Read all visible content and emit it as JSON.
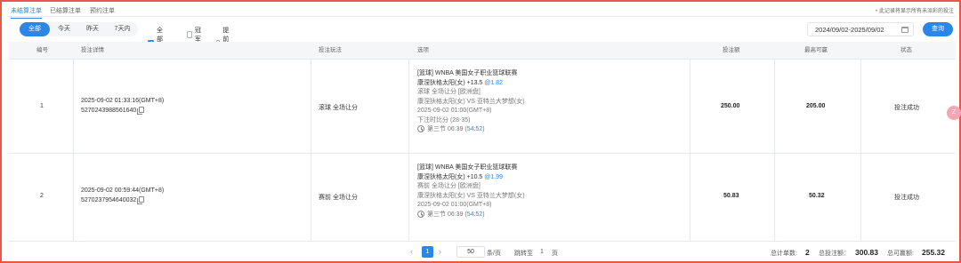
{
  "tabs": [
    {
      "label": "未结算注单",
      "active": true
    },
    {
      "label": "已结算注单",
      "active": false
    },
    {
      "label": "预约注单",
      "active": false
    }
  ],
  "notice": "此记录将显示所有未派彩的投注",
  "filters": {
    "ranges": [
      "全部",
      "今天",
      "昨天",
      "7天内"
    ],
    "active_range": "全部",
    "checkboxes": [
      {
        "label": "全部赛事",
        "checked": true
      },
      {
        "label": "冠军",
        "checked": false
      },
      {
        "label": "提前结算",
        "checked": false
      }
    ],
    "date_range": "2024/09/02-2025/09/02",
    "query_label": "查询"
  },
  "columns": [
    "编号",
    "投注详情",
    "投注玩法",
    "选项",
    "投注额",
    "最高可赢",
    "状态"
  ],
  "rows": [
    {
      "no": "1",
      "time": "2025-09-02 01:33:16(GMT+8)",
      "order_id": "5270243988561640",
      "play": "滚球   全场让分",
      "league": "[篮球] WNBA 美国女子职业篮球联赛",
      "pick": "康涅狄格太阳(女) +13.5",
      "odds": "@1.82",
      "market": "滚球   全场让分 [欧洲盘]",
      "match": "康涅狄格太阳(女) VS 亚特兰大梦想(女)",
      "kickoff": "2025-09-02 01:00(GMT+8)",
      "bet_score": "下注时比分 (28-35)",
      "period": "第三节  06:39",
      "score": "(54:52)",
      "stake": "250.00",
      "max_win": "205.00",
      "status": "投注成功"
    },
    {
      "no": "2",
      "time": "2025-09-02 00:59:44(GMT+8)",
      "order_id": "5270237954640032",
      "play": "赛前   全场让分",
      "league": "[篮球] WNBA 美国女子职业篮球联赛",
      "pick": "康涅狄格太阳(女) +10.5",
      "odds": "@1.99",
      "market": "赛前   全场让分 [欧洲盘]",
      "match": "康涅狄格太阳(女) VS 亚特兰大梦想(女)",
      "kickoff": "2025-09-02 01:00(GMT+8)",
      "bet_score": "",
      "period": "第三节  06:39",
      "score": "(54:52)",
      "stake": "50.83",
      "max_win": "50.32",
      "status": "投注成功"
    }
  ],
  "pagination": {
    "current_page": "1",
    "page_size": "50",
    "page_size_unit": "条/页",
    "jump_label": "跳转至",
    "jump_value": "1",
    "page_unit": "页"
  },
  "summary": {
    "count_label": "总计单数:",
    "count": "2",
    "stake_label": "总投注额：",
    "stake": "300.83",
    "win_label": "总可赢额:",
    "win": "255.32"
  },
  "float_badge": "Z"
}
